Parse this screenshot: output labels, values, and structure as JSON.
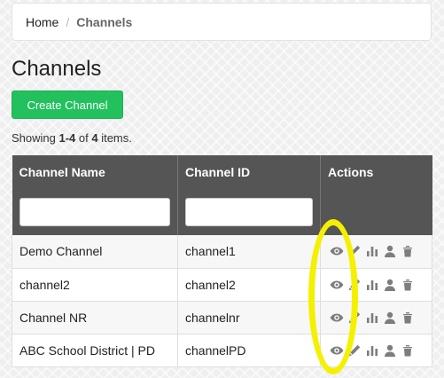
{
  "breadcrumb": {
    "home": "Home",
    "separator": "/",
    "current": "Channels"
  },
  "page_title": "Channels",
  "create_button": "Create Channel",
  "summary": {
    "prefix": "Showing ",
    "range": "1-4",
    "middle": " of ",
    "total": "4",
    "suffix": " items."
  },
  "table": {
    "headers": [
      "Channel Name",
      "Channel ID",
      "Actions"
    ],
    "rows": [
      {
        "name": "Demo Channel",
        "id": "channel1"
      },
      {
        "name": "channel2",
        "id": "channel2"
      },
      {
        "name": "Channel NR",
        "id": "channelnr"
      },
      {
        "name": "ABC School District | PD",
        "id": "channelPD"
      }
    ],
    "actions": [
      "view-icon",
      "edit-icon",
      "stats-icon",
      "user-icon",
      "delete-icon"
    ]
  },
  "colors": {
    "create_button": "#22c15e",
    "header_bg": "#555555",
    "highlight": "#f5f000",
    "icon": "#7d7d7d"
  }
}
